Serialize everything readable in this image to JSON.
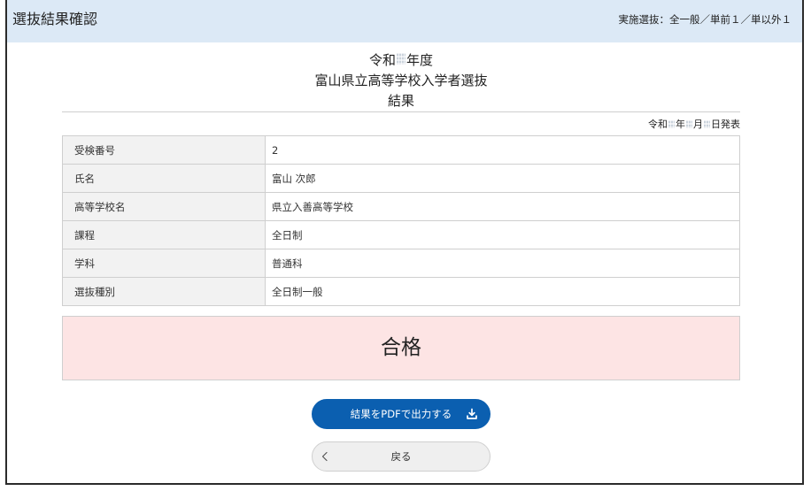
{
  "header": {
    "title": "選抜結果確認",
    "selection_info": "実施選抜：全一般／単前１／単以外１"
  },
  "result_title": {
    "era": "令和",
    "year_suffix": "年度",
    "exam_name": "富山県立高等学校入学者選抜",
    "heading": "結果"
  },
  "announcement": {
    "era": "令和",
    "year_unit": "年",
    "month_unit": "月",
    "day_suffix": "日発表"
  },
  "details": [
    {
      "label": "受検番号",
      "value": "2"
    },
    {
      "label": "氏名",
      "value": "富山 次郎"
    },
    {
      "label": "高等学校名",
      "value": "県立入善高等学校"
    },
    {
      "label": "課程",
      "value": "全日制"
    },
    {
      "label": "学科",
      "value": "普通科"
    },
    {
      "label": "選抜種別",
      "value": "全日制一般"
    }
  ],
  "result": {
    "status": "合格"
  },
  "actions": {
    "pdf_label": "結果をPDFで出力する",
    "back_label": "戻る"
  },
  "icons": {
    "pdf_button": "download-icon",
    "back_button": "chevron-left-icon"
  },
  "colors": {
    "header_background": "#dce9f6",
    "result_background": "#fde4e4",
    "primary_button": "#0b5fb0",
    "secondary_button": "#efefef",
    "label_cell_background": "#f2f2f2"
  }
}
